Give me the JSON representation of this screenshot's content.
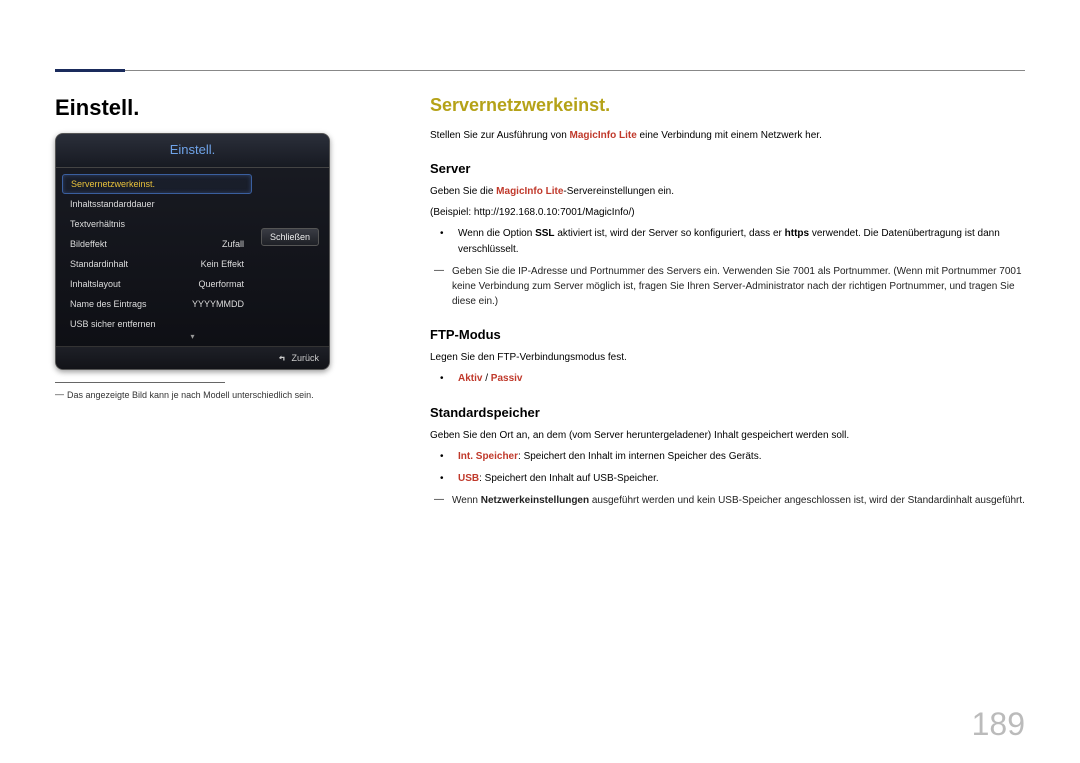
{
  "page_number": "189",
  "left": {
    "heading": "Einstell.",
    "device": {
      "title": "Einstell.",
      "menu": [
        {
          "label": "Servernetzwerkeinst.",
          "value": "",
          "selected": true
        },
        {
          "label": "Inhaltsstandarddauer",
          "value": ""
        },
        {
          "label": "Textverhältnis",
          "value": ""
        },
        {
          "label": "Bildeffekt",
          "value": "Zufall"
        },
        {
          "label": "Standardinhalt",
          "value": "Kein Effekt"
        },
        {
          "label": "Inhaltslayout",
          "value": "Querformat"
        },
        {
          "label": "Name des Eintrags",
          "value": "YYYYMMDD"
        },
        {
          "label": "USB sicher entfernen",
          "value": ""
        }
      ],
      "close_label": "Schließen",
      "footer_back": "Zurück"
    },
    "note": "Das angezeigte Bild kann je nach Modell unterschiedlich sein."
  },
  "right": {
    "section_title": "Servernetzwerkeinst.",
    "intro_pre": "Stellen Sie zur Ausführung von ",
    "intro_hl": "MagicInfo Lite",
    "intro_post": " eine Verbindung mit einem Netzwerk her.",
    "server": {
      "heading": "Server",
      "p1_pre": "Geben Sie die ",
      "p1_hl": "MagicInfo Lite",
      "p1_post": "-Servereinstellungen ein.",
      "p2": "(Beispiel: http://192.168.0.10:7001/MagicInfo/)",
      "b1_pre": "Wenn die Option ",
      "b1_strong": "SSL",
      "b1_mid": " aktiviert ist, wird der Server so konfiguriert, dass er ",
      "b1_strong2": "https",
      "b1_post": " verwendet. Die Datenübertragung ist dann verschlüsselt.",
      "dash": "Geben Sie die IP-Adresse und Portnummer des Servers ein. Verwenden Sie 7001 als Portnummer. (Wenn mit Portnummer 7001 keine Verbindung zum Server möglich ist, fragen Sie Ihren Server-Administrator nach der richtigen Portnummer, und tragen Sie diese ein.)"
    },
    "ftp": {
      "heading": "FTP-Modus",
      "p1": "Legen Sie den FTP-Verbindungsmodus fest.",
      "b1_hl1": "Aktiv",
      "b1_sep": " / ",
      "b1_hl2": "Passiv"
    },
    "storage": {
      "heading": "Standardspeicher",
      "p1": "Geben Sie den Ort an, an dem (vom Server heruntergeladener) Inhalt gespeichert werden soll.",
      "b1_hl": "Int. Speicher",
      "b1_post": ": Speichert den Inhalt im internen Speicher des Geräts.",
      "b2_hl": "USB",
      "b2_post": ": Speichert den Inhalt auf USB-Speicher.",
      "dash_pre": "Wenn ",
      "dash_strong": "Netzwerkeinstellungen",
      "dash_post": " ausgeführt werden und kein USB-Speicher angeschlossen ist, wird der Standardinhalt ausgeführt."
    }
  }
}
